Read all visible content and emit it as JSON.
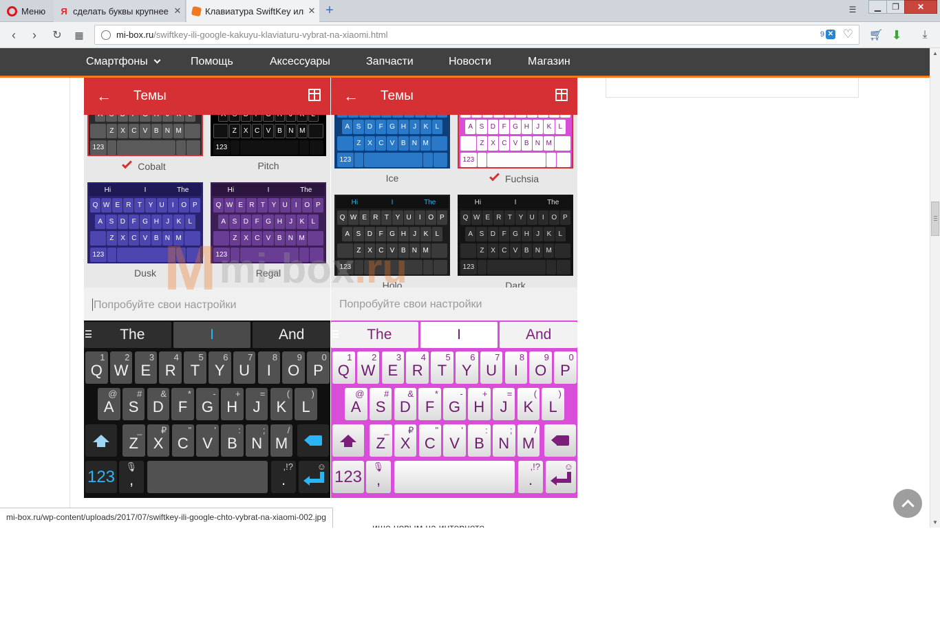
{
  "browser": {
    "menu_label": "Меню",
    "tabs": [
      {
        "title": "сделать буквы крупнее н",
        "favicon": "yandex-icon"
      },
      {
        "title": "Клавиатура SwiftKey или",
        "favicon": "mibox-icon"
      }
    ],
    "url_host": "mi-box.ru",
    "url_path": "/swiftkey-ili-google-kakuyu-klaviaturu-vybrat-na-xiaomi.html",
    "adblock_count": "9",
    "status_url": "mi-box.ru/wp-content/uploads/2017/07/swiftkey-ili-google-chto-vybrat-na-xiaomi-002.jpg"
  },
  "site_nav": {
    "items": [
      "Смартфоны",
      "Помощь",
      "Аксессуары",
      "Запчасти",
      "Новости",
      "Магазин"
    ]
  },
  "below_text": "ише новым на интернете",
  "watermark": {
    "logo": "M",
    "text": "mi-box",
    "tld": ".ru"
  },
  "phones": [
    {
      "title": "Темы",
      "themes": [
        {
          "name": "Cobalt",
          "selected": true
        },
        {
          "name": "Pitch",
          "selected": false
        },
        {
          "name": "Dusk",
          "selected": false
        },
        {
          "name": "Regal",
          "selected": false
        }
      ],
      "try_placeholder": "Попробуйте свои настройки",
      "suggestions": [
        "The",
        "I",
        "And"
      ],
      "num_label": "123"
    },
    {
      "title": "Темы",
      "themes": [
        {
          "name": "Ice",
          "selected": false
        },
        {
          "name": "Fuchsia",
          "selected": true
        },
        {
          "name": "Holo",
          "selected": false
        },
        {
          "name": "Dark",
          "selected": false
        }
      ],
      "try_placeholder": "Попробуйте свои настройки",
      "suggestions": [
        "The",
        "I",
        "And"
      ],
      "num_label": "123"
    }
  ],
  "keyboard": {
    "row1": [
      [
        "Q",
        "1"
      ],
      [
        "W",
        "2"
      ],
      [
        "E",
        "3"
      ],
      [
        "R",
        "4"
      ],
      [
        "T",
        "5"
      ],
      [
        "Y",
        "6"
      ],
      [
        "U",
        "7"
      ],
      [
        "I",
        "8"
      ],
      [
        "O",
        "9"
      ],
      [
        "P",
        "0"
      ]
    ],
    "row2": [
      [
        "A",
        "@"
      ],
      [
        "S",
        "#"
      ],
      [
        "D",
        "&"
      ],
      [
        "F",
        "*"
      ],
      [
        "G",
        "-"
      ],
      [
        "H",
        "+"
      ],
      [
        "J",
        "="
      ],
      [
        "K",
        "("
      ],
      [
        "L",
        ")"
      ]
    ],
    "row3": [
      [
        "Z",
        "_"
      ],
      [
        "X",
        "₽"
      ],
      [
        "C",
        "\""
      ],
      [
        "V",
        "'"
      ],
      [
        "B",
        ":"
      ],
      [
        "N",
        ";"
      ],
      [
        "M",
        "/"
      ]
    ],
    "comma": ",",
    "period": ".",
    "period_alt": ",!?"
  },
  "mini_keyboard": {
    "sug": [
      "Hi",
      "I",
      "The"
    ],
    "row1": "QWERTYUIOP",
    "row2": "ASDFGHJKL",
    "row3": "ZXCVBNM",
    "num": "123"
  },
  "colors": {
    "accent_red": "#d53033",
    "nav_orange": "#f47b20",
    "fuchsia": "#d94ed9",
    "dark_bg": "#101010"
  }
}
